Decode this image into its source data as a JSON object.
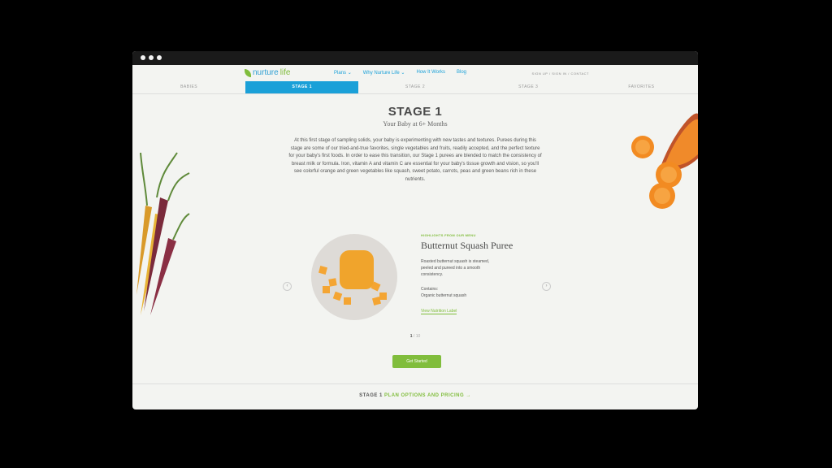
{
  "nav": {
    "brand_a": "nurture",
    "brand_b": "life",
    "items": [
      "Plans",
      "Why Nurture Life",
      "How It Works",
      "Blog"
    ],
    "account": "SIGN UP / SIGN IN / CONTACT"
  },
  "stage_tabs": [
    "BABIES",
    "STAGE 1",
    "STAGE 2",
    "STAGE 3",
    "FAVORITES"
  ],
  "hero": {
    "title": "STAGE 1",
    "subtitle": "Your Baby at 6+ Months",
    "description": "At this first stage of sampling solids, your baby is experimenting with new tastes and textures. Purees during this stage are some of our tried-and-true favorites, single vegetables and fruits, readily accepted, and the perfect texture for your baby's first foods. In order to ease this transition, our Stage 1 purees are blended to match the consistency of breast milk or formula. Iron, vitamin A and vitamin C are essential for your baby's tissue growth and vision, so you'll see colorful orange and green vegetables like squash, sweet potato, carrots, peas and green beans rich in these nutrients."
  },
  "menu_item": {
    "highlight": "HIGHLIGHTS FROM OUR MENU",
    "title": "Butternut Squash Puree",
    "description": "Roasted butternut squash is steamed, peeled and pureed into a smooth consistency.",
    "contains_label": "Contains:",
    "contains": "Organic butternut squash",
    "link": "View Nutrition Label"
  },
  "pager": {
    "current": "1",
    "sep": "/",
    "total": "10"
  },
  "cta": "Get Started",
  "footer": {
    "a": "STAGE 1",
    "b": "PLAN OPTIONS AND PRICING →"
  },
  "colors": {
    "blue": "#1aa0d8",
    "green": "#80bd3c"
  }
}
